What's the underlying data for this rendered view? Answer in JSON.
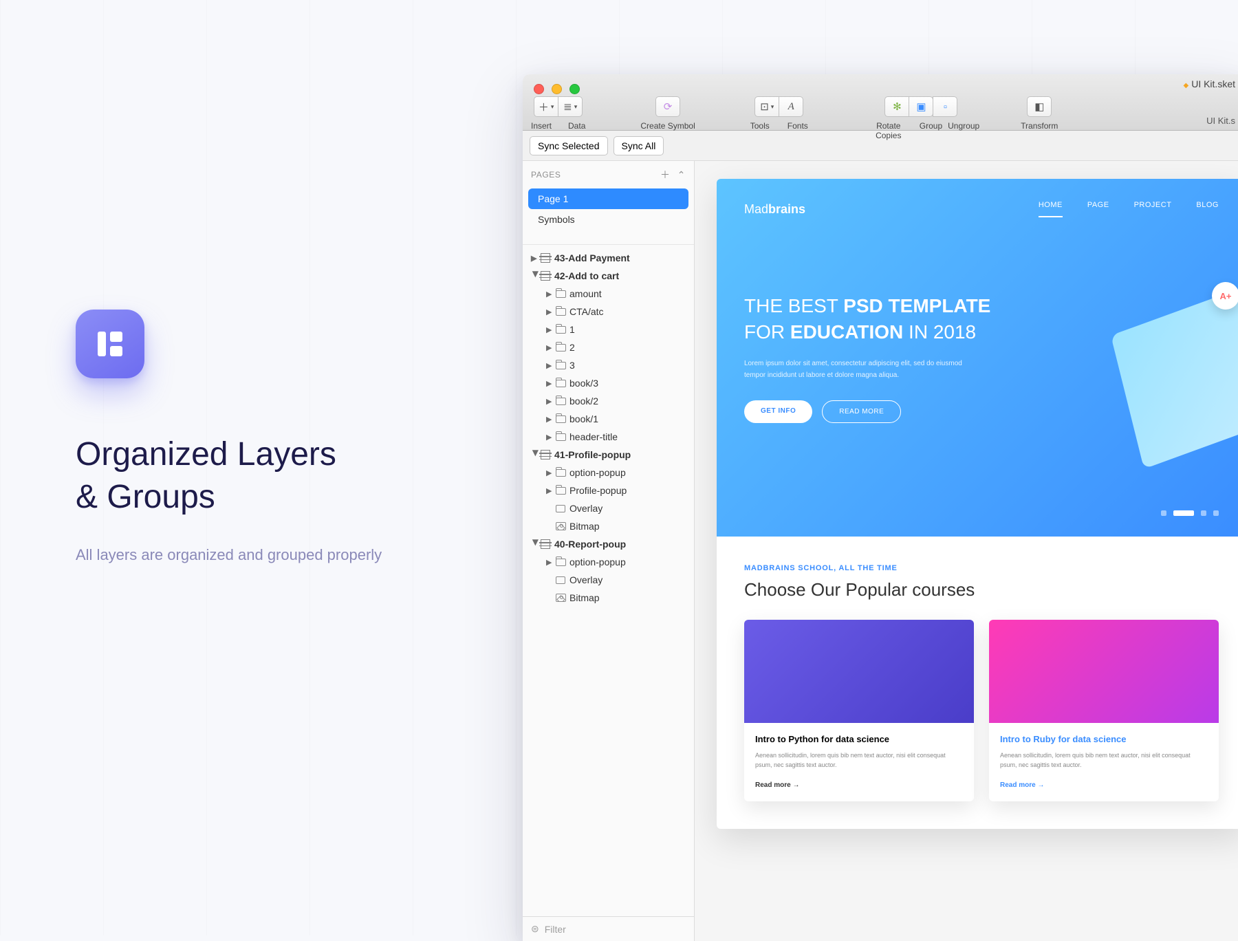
{
  "promo": {
    "title_line1": "Organized Layers",
    "title_line2": "& Groups",
    "subtitle": "All layers are organized and grouped properly"
  },
  "window": {
    "title": "UI Kit.sket",
    "subtitle": "UI Kit.s",
    "toolbar": {
      "insert": "Insert",
      "data": "Data",
      "create_symbol": "Create Symbol",
      "tools": "Tools",
      "fonts": "Fonts",
      "rotate_copies": "Rotate Copies",
      "group": "Group",
      "ungroup": "Ungroup",
      "transform": "Transform"
    },
    "sync_selected": "Sync Selected",
    "sync_all": "Sync All"
  },
  "sidebar": {
    "pages_label": "PAGES",
    "pages": [
      "Page 1",
      "Symbols"
    ],
    "filter_label": "Filter",
    "layers": [
      {
        "depth": 1,
        "type": "artboard",
        "open": false,
        "bold": true,
        "label": "43-Add Payment"
      },
      {
        "depth": 1,
        "type": "artboard",
        "open": true,
        "bold": true,
        "label": "42-Add to cart"
      },
      {
        "depth": 2,
        "type": "folder",
        "open": false,
        "label": "amount"
      },
      {
        "depth": 2,
        "type": "folder",
        "open": false,
        "label": "CTA/atc"
      },
      {
        "depth": 2,
        "type": "folder",
        "open": false,
        "label": "1"
      },
      {
        "depth": 2,
        "type": "folder",
        "open": false,
        "label": "2"
      },
      {
        "depth": 2,
        "type": "folder",
        "open": false,
        "label": "3"
      },
      {
        "depth": 2,
        "type": "folder",
        "open": false,
        "label": "book/3"
      },
      {
        "depth": 2,
        "type": "folder",
        "open": false,
        "label": "book/2"
      },
      {
        "depth": 2,
        "type": "folder",
        "open": false,
        "label": "book/1"
      },
      {
        "depth": 2,
        "type": "folder",
        "open": false,
        "label": "header-title"
      },
      {
        "depth": 1,
        "type": "artboard",
        "open": true,
        "bold": true,
        "label": "41-Profile-popup"
      },
      {
        "depth": 2,
        "type": "folder",
        "open": false,
        "label": "option-popup"
      },
      {
        "depth": 2,
        "type": "folder",
        "open": false,
        "label": "Profile-popup"
      },
      {
        "depth": 2,
        "type": "rect",
        "label": "Overlay"
      },
      {
        "depth": 2,
        "type": "bitmap",
        "label": "Bitmap"
      },
      {
        "depth": 1,
        "type": "artboard",
        "open": true,
        "bold": true,
        "label": "40-Report-poup"
      },
      {
        "depth": 2,
        "type": "folder",
        "open": false,
        "label": "option-popup"
      },
      {
        "depth": 2,
        "type": "rect",
        "label": "Overlay"
      },
      {
        "depth": 2,
        "type": "bitmap",
        "label": "Bitmap"
      }
    ]
  },
  "design": {
    "brand_a": "Mad",
    "brand_b": "brains",
    "nav": [
      "HOME",
      "PAGE",
      "PROJECT",
      "BLOG"
    ],
    "hero_l1_a": "THE BEST ",
    "hero_l1_b": "PSD TEMPLATE",
    "hero_l2_a": "FOR ",
    "hero_l2_b": "EDUCATION",
    "hero_l2_c": " IN 2018",
    "hero_desc": "Lorem ipsum dolor sit amet, consectetur adipiscing elit, sed do eiusmod tempor incididunt ut labore et dolore magna aliqua.",
    "cta1": "GET INFO",
    "cta2": "READ MORE",
    "badge": "A+",
    "eyebrow": "MADBRAINS SCHOOL, ALL THE TIME",
    "heading": "Choose Our Popular courses",
    "cards": [
      {
        "title": "Intro to Python for data science",
        "desc": "Aenean sollicitudin, lorem quis bib nem text auctor, nisi elit consequat psum, nec sagittis text auctor.",
        "link": "Read more"
      },
      {
        "title": "Intro to Ruby for data science",
        "desc": "Aenean sollicitudin, lorem quis bib nem text auctor, nisi elit consequat psum, nec sagittis text auctor.",
        "link": "Read more"
      }
    ]
  }
}
